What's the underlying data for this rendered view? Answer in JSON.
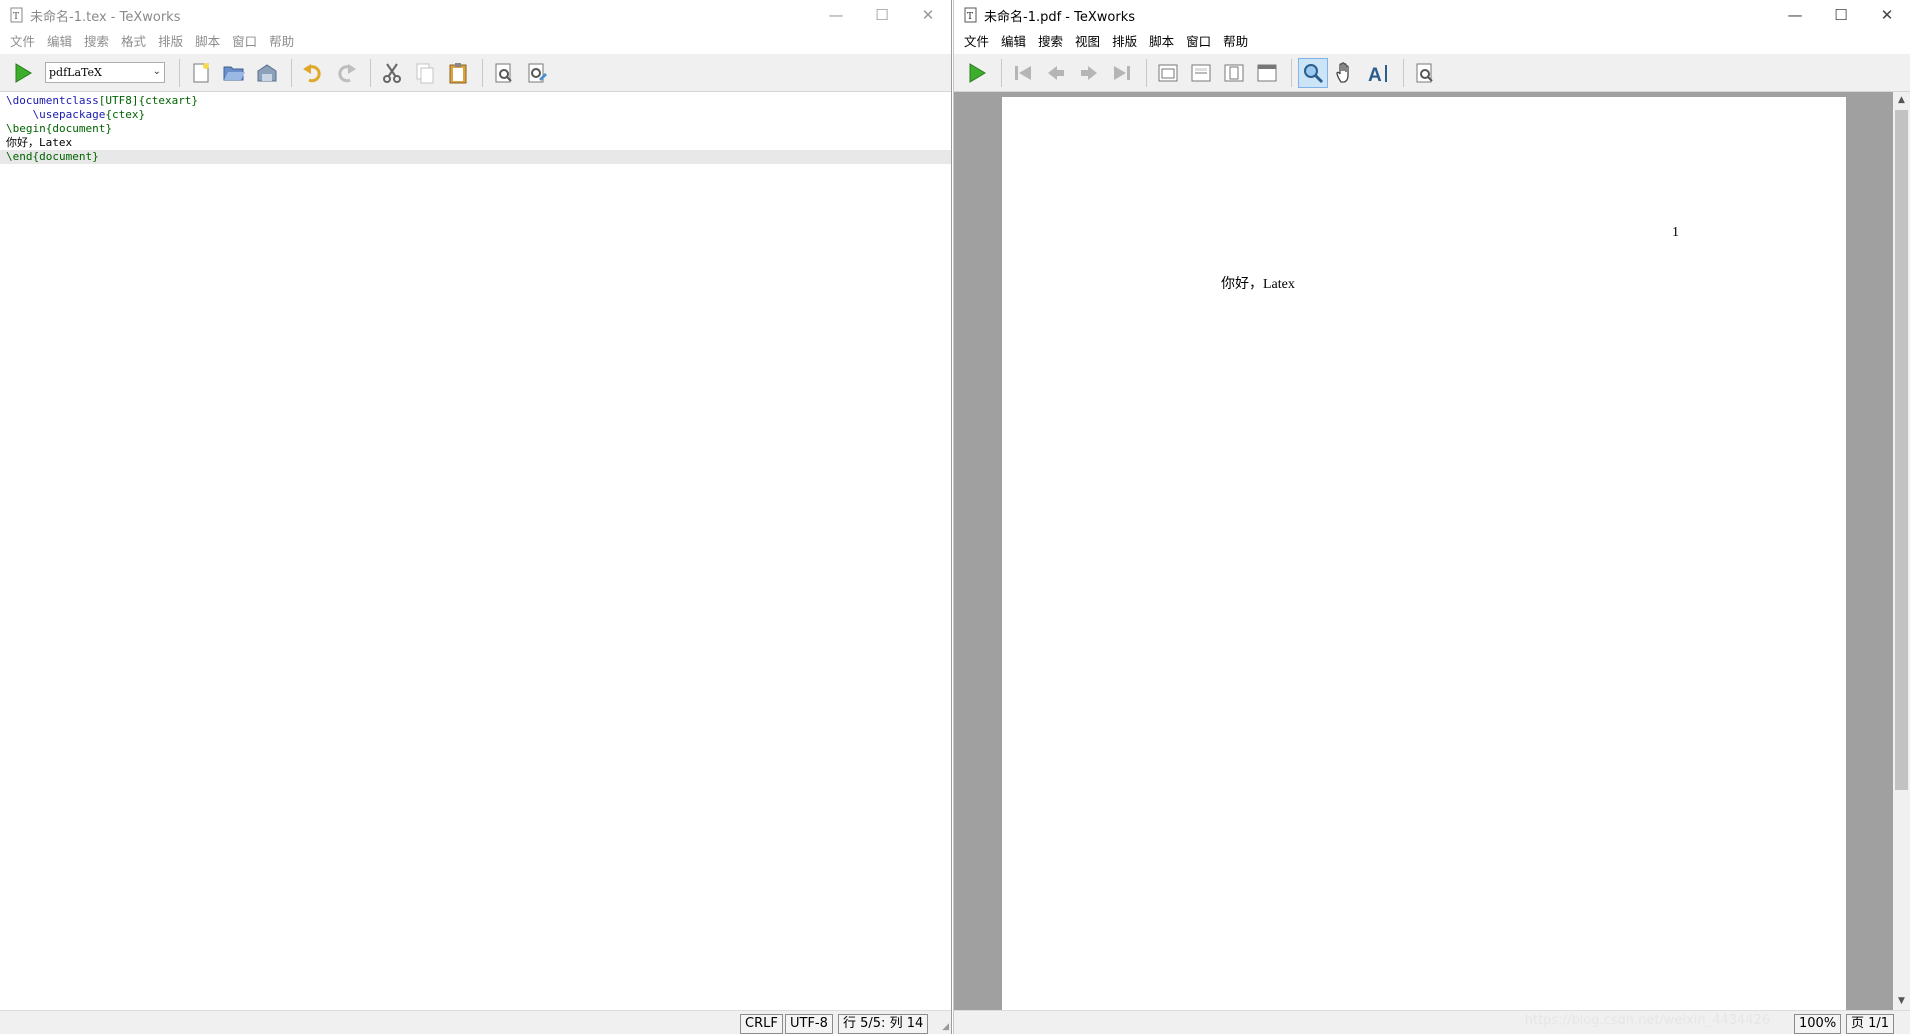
{
  "left_window": {
    "title": "未命名-1.tex - TeXworks",
    "menu": [
      "文件",
      "编辑",
      "搜索",
      "格式",
      "排版",
      "脚本",
      "窗口",
      "帮助"
    ],
    "engine": "pdfLaTeX",
    "editor_lines": [
      {
        "cmd": "\\documentclass",
        "rest": "[UTF8]{ctexart}"
      },
      {
        "cmd": "    \\usepackage",
        "rest": "{ctex}"
      },
      {
        "cmd": "\\begin",
        "rest": "{document}"
      },
      {
        "cmd": "",
        "rest": "你好，Latex"
      },
      {
        "cmd": "\\end",
        "rest": "{document}"
      }
    ],
    "status": {
      "line_ending": "CRLF",
      "encoding": "UTF-8",
      "position": "行 5/5: 列 14"
    }
  },
  "right_window": {
    "title": "未命名-1.pdf - TeXworks",
    "menu": [
      "文件",
      "编辑",
      "搜索",
      "视图",
      "排版",
      "脚本",
      "窗口",
      "帮助"
    ],
    "page_number": "1",
    "page_text": "你好，Latex",
    "status": {
      "zoom": "100%",
      "page": "页 1/1"
    },
    "watermark": "https://blog.csdn.net/weixin_4434426"
  },
  "window_controls": {
    "minimize": "—",
    "maximize": "☐",
    "close": "✕"
  }
}
